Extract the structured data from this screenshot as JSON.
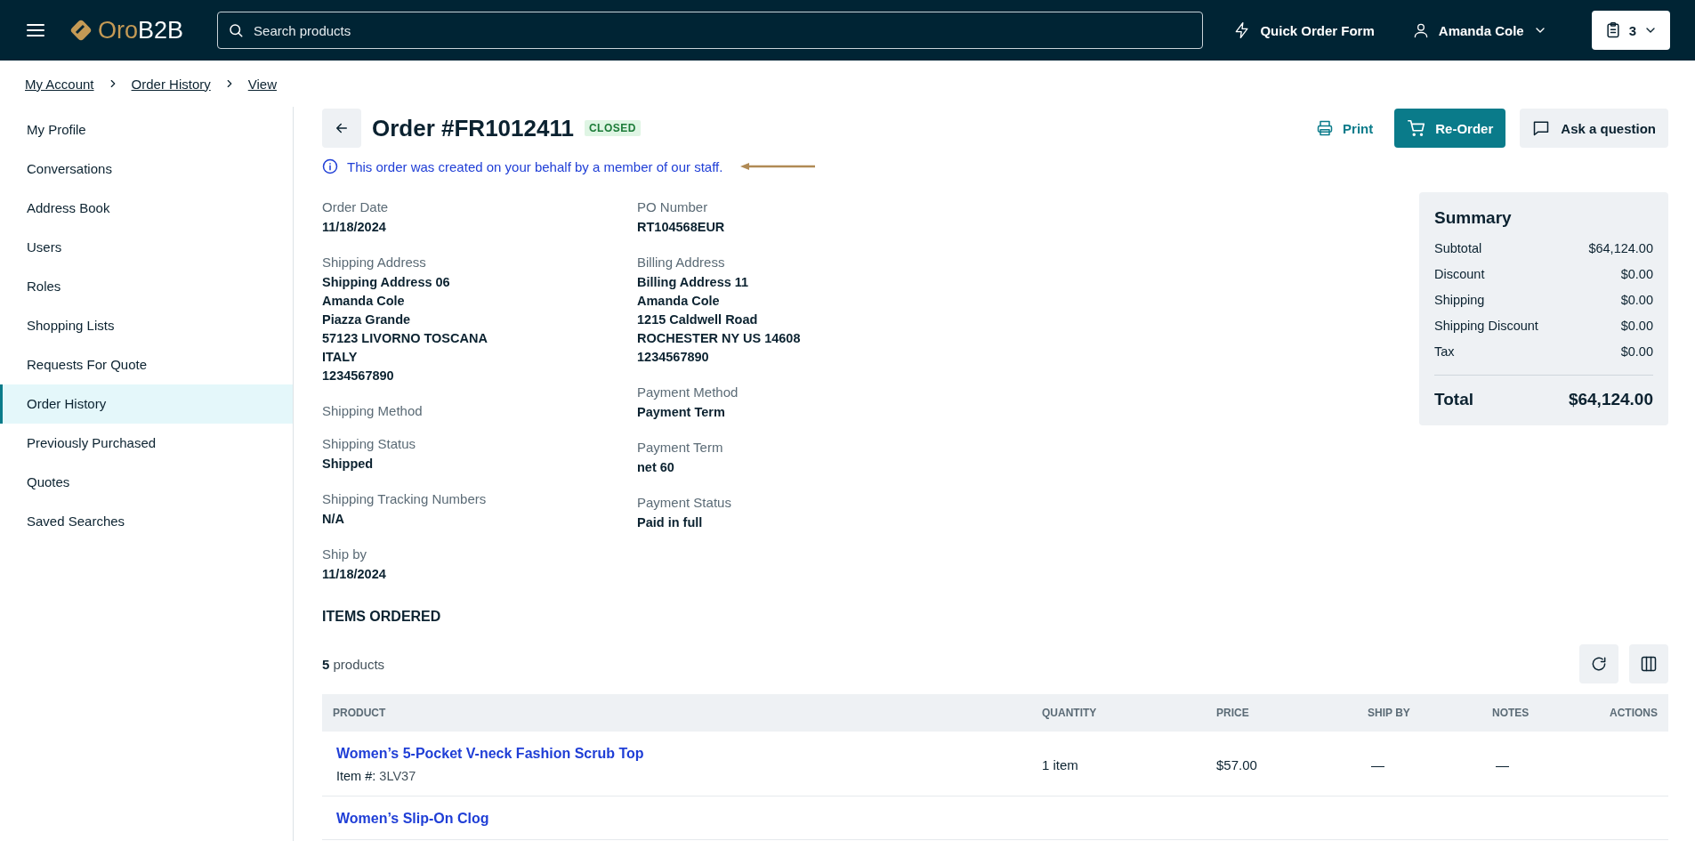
{
  "header": {
    "logo_parts": [
      "Oro",
      "B2B"
    ],
    "search": {
      "placeholder": "Search products"
    },
    "quick_order": "Quick Order Form",
    "user": "Amanda Cole",
    "cart_count": "3"
  },
  "breadcrumb": [
    "My Account",
    "Order History",
    "View"
  ],
  "sidebar": {
    "items": [
      {
        "label": "My Profile",
        "selected": false
      },
      {
        "label": "Conversations",
        "selected": false
      },
      {
        "label": "Address Book",
        "selected": false
      },
      {
        "label": "Users",
        "selected": false
      },
      {
        "label": "Roles",
        "selected": false
      },
      {
        "label": "Shopping Lists",
        "selected": false
      },
      {
        "label": "Requests For Quote",
        "selected": false
      },
      {
        "label": "Order History",
        "selected": true
      },
      {
        "label": "Previously Purchased",
        "selected": false
      },
      {
        "label": "Quotes",
        "selected": false
      },
      {
        "label": "Saved Searches",
        "selected": false
      }
    ]
  },
  "order": {
    "title": "Order #FR1012411",
    "status": "CLOSED",
    "actions": {
      "print": "Print",
      "reorder": "Re-Order",
      "ask": "Ask a question"
    },
    "notice": "This order was created on your behalf by a member of our staff.",
    "details_left": [
      {
        "label": "Order Date",
        "lines": [
          "11/18/2024"
        ]
      },
      {
        "label": "Shipping Address",
        "lines": [
          "Shipping Address 06",
          "Amanda Cole",
          "Piazza Grande",
          "57123 LIVORNO TOSCANA",
          "ITALY",
          "1234567890"
        ]
      },
      {
        "label": "Shipping Method"
      },
      {
        "label": "Shipping Status",
        "lines": [
          "Shipped"
        ]
      },
      {
        "label": "Shipping Tracking Numbers",
        "lines": [
          "N/A"
        ]
      },
      {
        "label": "Ship by",
        "lines": [
          "11/18/2024"
        ]
      }
    ],
    "details_right": [
      {
        "label": "PO Number",
        "lines": [
          "RT104568EUR"
        ]
      },
      {
        "label": "Billing Address",
        "lines": [
          "Billing Address 11",
          "Amanda Cole",
          "1215 Caldwell Road",
          "ROCHESTER NY US 14608",
          "1234567890"
        ]
      },
      {
        "label": "Payment Method",
        "lines": [
          "Payment Term"
        ]
      },
      {
        "label": "Payment Term",
        "lines": [
          "net 60"
        ]
      },
      {
        "label": "Payment Status",
        "lines": [
          "Paid in full"
        ]
      }
    ],
    "summary": {
      "title": "Summary",
      "rows": [
        {
          "label": "Subtotal",
          "value": "$64,124.00"
        },
        {
          "label": "Discount",
          "value": "$0.00"
        },
        {
          "label": "Shipping",
          "value": "$0.00"
        },
        {
          "label": "Shipping Discount",
          "value": "$0.00"
        },
        {
          "label": "Tax",
          "value": "$0.00"
        }
      ],
      "total_label": "Total",
      "total_value": "$64,124.00"
    }
  },
  "items": {
    "heading": "ITEMS ORDERED",
    "count": "**5** products",
    "table": {
      "columns": [
        "PRODUCT",
        "QUANTITY",
        "PRICE",
        "SHIP BY",
        "NOTES",
        "ACTIONS"
      ],
      "rows": [
        {
          "product": "Women’s 5-Pocket V-neck Fashion Scrub Top",
          "item_label": "Item #:",
          "sku": "3LV37",
          "quantity": "1 item",
          "price": "$57.00",
          "ship_by": "—",
          "notes": "—"
        },
        {
          "product": "Women’s Slip-On Clog"
        }
      ]
    }
  }
}
